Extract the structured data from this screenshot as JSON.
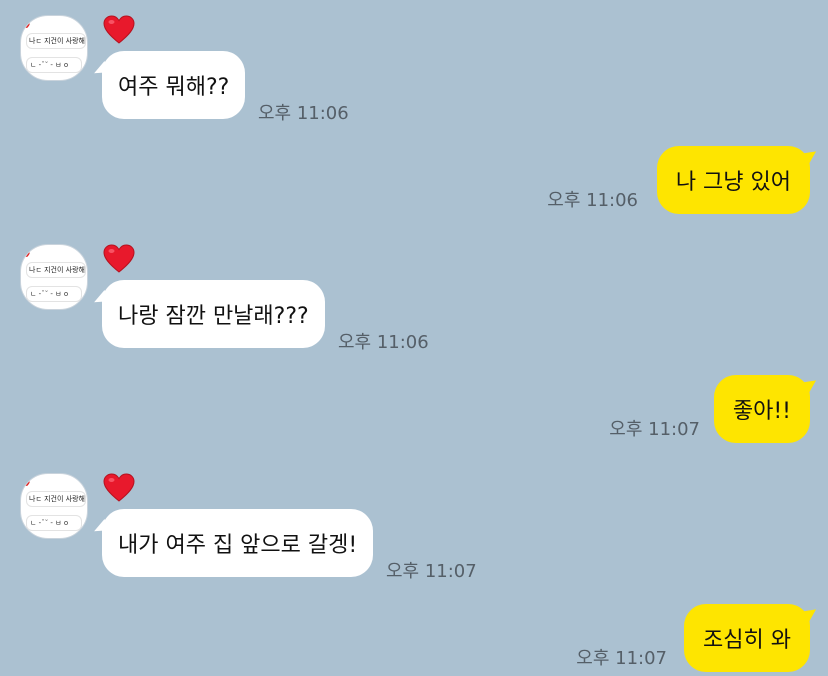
{
  "avatar": {
    "line1": "나ㄷ 지건이 사랑해",
    "line2": "ㄴ -ˇ˘ -  ㅂ o"
  },
  "messages": [
    {
      "from": "other",
      "text": "여주 뭐해??",
      "time": "오후 11:06"
    },
    {
      "from": "me",
      "text": "나 그냥 있어",
      "time": "오후 11:06"
    },
    {
      "from": "other",
      "text": "나랑 잠깐 만날래???",
      "time": "오후 11:06"
    },
    {
      "from": "me",
      "text": "좋아!!",
      "time": "오후 11:07"
    },
    {
      "from": "other",
      "text": "내가 여주 집 앞으로 갈겡!",
      "time": "오후 11:07"
    },
    {
      "from": "me",
      "text": "조심히 와",
      "time": "오후 11:07"
    }
  ],
  "colors": {
    "background": "#abc1d1",
    "incoming_bubble": "#ffffff",
    "outgoing_bubble": "#fee500",
    "heart": "#e8192c"
  },
  "icons": {
    "reaction": "heart-icon"
  }
}
